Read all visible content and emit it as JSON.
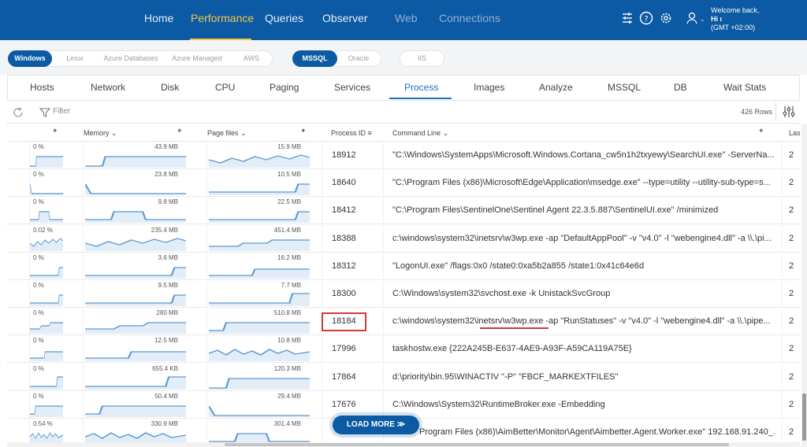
{
  "colors": {
    "brand": "#0b5aa3",
    "accent": "#f5c54a",
    "highlight": "#d23a3a",
    "link": "#1a6fbe"
  },
  "nav": {
    "items": [
      "Home",
      "Performance",
      "Queries",
      "Observer",
      "Web",
      "Connections"
    ],
    "active": "Performance"
  },
  "user": {
    "welcome": "Welcome back,",
    "name": "Hi ı",
    "timezone": "(GMT +02:00)",
    "icons": [
      "settings-sliders-icon",
      "help-icon",
      "gear-icon",
      "user-icon"
    ]
  },
  "subnav": {
    "os": [
      "Windows",
      "Linux",
      "Azure Databases",
      "Azure Managed",
      "AWS"
    ],
    "db": [
      "MSSQL",
      "Oracle"
    ],
    "iis": "IIS"
  },
  "tabs": [
    "Hosts",
    "Network",
    "Disk",
    "CPU",
    "Paging",
    "Services",
    "Process",
    "Images",
    "Analyze",
    "MSSQL",
    "DB",
    "Wait Stats"
  ],
  "active_tab": "Process",
  "filter": {
    "label": "Filter",
    "rows": "426 Rows"
  },
  "columns": {
    "memory": "Memory",
    "page_files": "Page files",
    "process_id": "Process ID",
    "command_line": "Command Line",
    "last": "Las"
  },
  "rows": [
    {
      "cpu": "0 %",
      "mem": "43.9 MB",
      "page": "15.9 MB",
      "pid": "18912",
      "cmd": "\"C:\\Windows\\SystemApps\\Microsoft.Windows.Cortana_cw5n1h2txyewy\\SearchUI.exe\" -ServerNa...",
      "last": "2"
    },
    {
      "cpu": "0 %",
      "mem": "23.8 MB",
      "page": "10.5 MB",
      "pid": "18640",
      "cmd": "\"C:\\Program Files (x86)\\Microsoft\\Edge\\Application\\msedge.exe\" --type=utility --utility-sub-type=s...",
      "last": "2"
    },
    {
      "cpu": "0 %",
      "mem": "9.8 MB",
      "page": "22.5 MB",
      "pid": "18412",
      "cmd": "\"C:\\Program Files\\SentinelOne\\Sentinel Agent 22.3.5.887\\SentinelUI.exe\" /minimized",
      "last": "2"
    },
    {
      "cpu": "0.02 %",
      "mem": "235.4 MB",
      "page": "451.4 MB",
      "pid": "18388",
      "cmd": "c:\\windows\\system32\\inetsrv\\w3wp.exe -ap \"DefaultAppPool\" -v \"v4.0\" -l \"webengine4.dll\" -a \\\\.\\pi...",
      "last": "2"
    },
    {
      "cpu": "0 %",
      "mem": "3.6 MB",
      "page": "16.2 MB",
      "pid": "18312",
      "cmd": "\"LogonUI.exe\" /flags:0x0 /state0:0xa5b2a855 /state1:0x41c64e6d",
      "last": "2"
    },
    {
      "cpu": "0 %",
      "mem": "9.5 MB",
      "page": "7.7 MB",
      "pid": "18300",
      "cmd": "C:\\Windows\\system32\\svchost.exe -k UnistackSvcGroup",
      "last": "2"
    },
    {
      "cpu": "0 %",
      "mem": "280 MB",
      "page": "510.8 MB",
      "pid": "18184",
      "cmd": "c:\\windows\\system32\\inetsrv\\w3wp.exe -ap \"RunStatuses\" -v \"v4.0\" -l \"webengine4.dll\" -a \\\\.\\pipe...",
      "last": "2"
    },
    {
      "cpu": "0 %",
      "mem": "12.5 MB",
      "page": "10.8 MB",
      "pid": "17996",
      "cmd": "taskhostw.exe {222A245B-E637-4AE9-A93F-A59CA119A75E}",
      "last": "2"
    },
    {
      "cpu": "0 %",
      "mem": "655.4 KB",
      "page": "120.3 MB",
      "pid": "17864",
      "cmd": "d:\\priority\\bin.95\\WINACTIV \"-P\" \"FBCF_MARKEXTFILES\"",
      "last": "2"
    },
    {
      "cpu": "0 %",
      "mem": "50.4 MB",
      "page": "29.4 MB",
      "pid": "17676",
      "cmd": "C:\\Windows\\System32\\RuntimeBroker.exe -Embedding",
      "last": "2"
    },
    {
      "cpu": "0.54 %",
      "mem": "330.9 MB",
      "page": "301.4 MB",
      "pid": "",
      "cmd": "Program Files (x86)\\AimBetter\\Monitor\\Agent\\Aimbetter.Agent.Worker.exe\" 192.168.91.240_...",
      "last": "2"
    }
  ],
  "load_more": "LOAD MORE ≫"
}
